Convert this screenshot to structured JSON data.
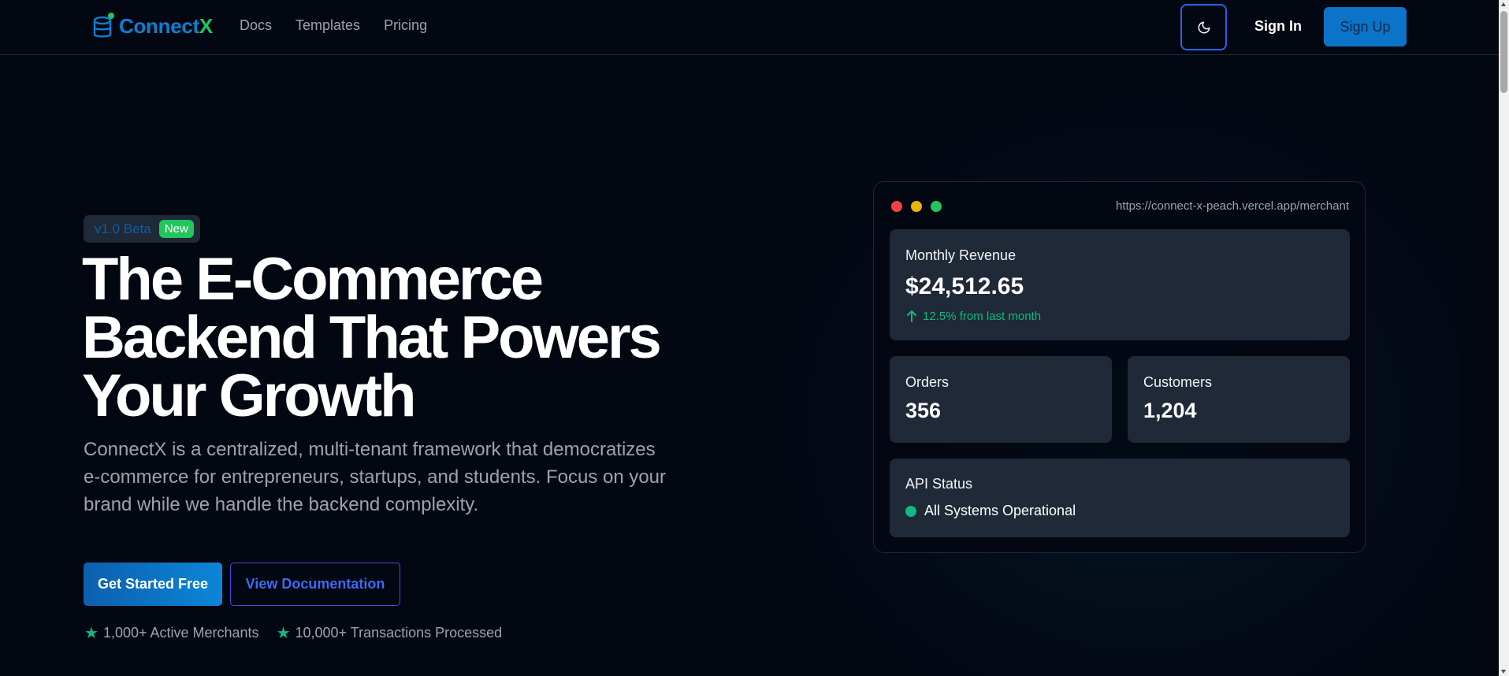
{
  "brand": {
    "name_main": "Connect",
    "name_accent": "X",
    "primary_color": "#0e7fd0",
    "accent_color": "#22c55e"
  },
  "nav": {
    "links": [
      "Docs",
      "Templates",
      "Pricing"
    ],
    "theme_toggle_icon": "moon-icon",
    "sign_in": "Sign In",
    "sign_up": "Sign Up"
  },
  "hero": {
    "badge_version": "v1.0 Beta",
    "badge_new": "New",
    "headline_lines": [
      "The E-Commerce",
      "Backend That Powers",
      "Your Growth"
    ],
    "subtext": "ConnectX is a centralized, multi-tenant framework that democratizes e-commerce for entrepreneurs, startups, and students. Focus on your brand while we handle the backend complexity.",
    "cta_primary": "Get Started Free",
    "cta_secondary": "View Documentation",
    "stats": [
      "1,000+ Active Merchants",
      "10,000+ Transactions Processed"
    ]
  },
  "dashboard": {
    "url": "https://connect-x-peach.vercel.app/merchant",
    "window_dots": [
      "#ef4444",
      "#eab308",
      "#22c55e"
    ],
    "revenue": {
      "label": "Monthly Revenue",
      "value": "$24,512.65",
      "trend": "12.5% from last month"
    },
    "orders": {
      "label": "Orders",
      "value": "356"
    },
    "customers": {
      "label": "Customers",
      "value": "1,204"
    },
    "api": {
      "label": "API Status",
      "status": "All Systems Operational",
      "status_color": "#10b981"
    }
  }
}
